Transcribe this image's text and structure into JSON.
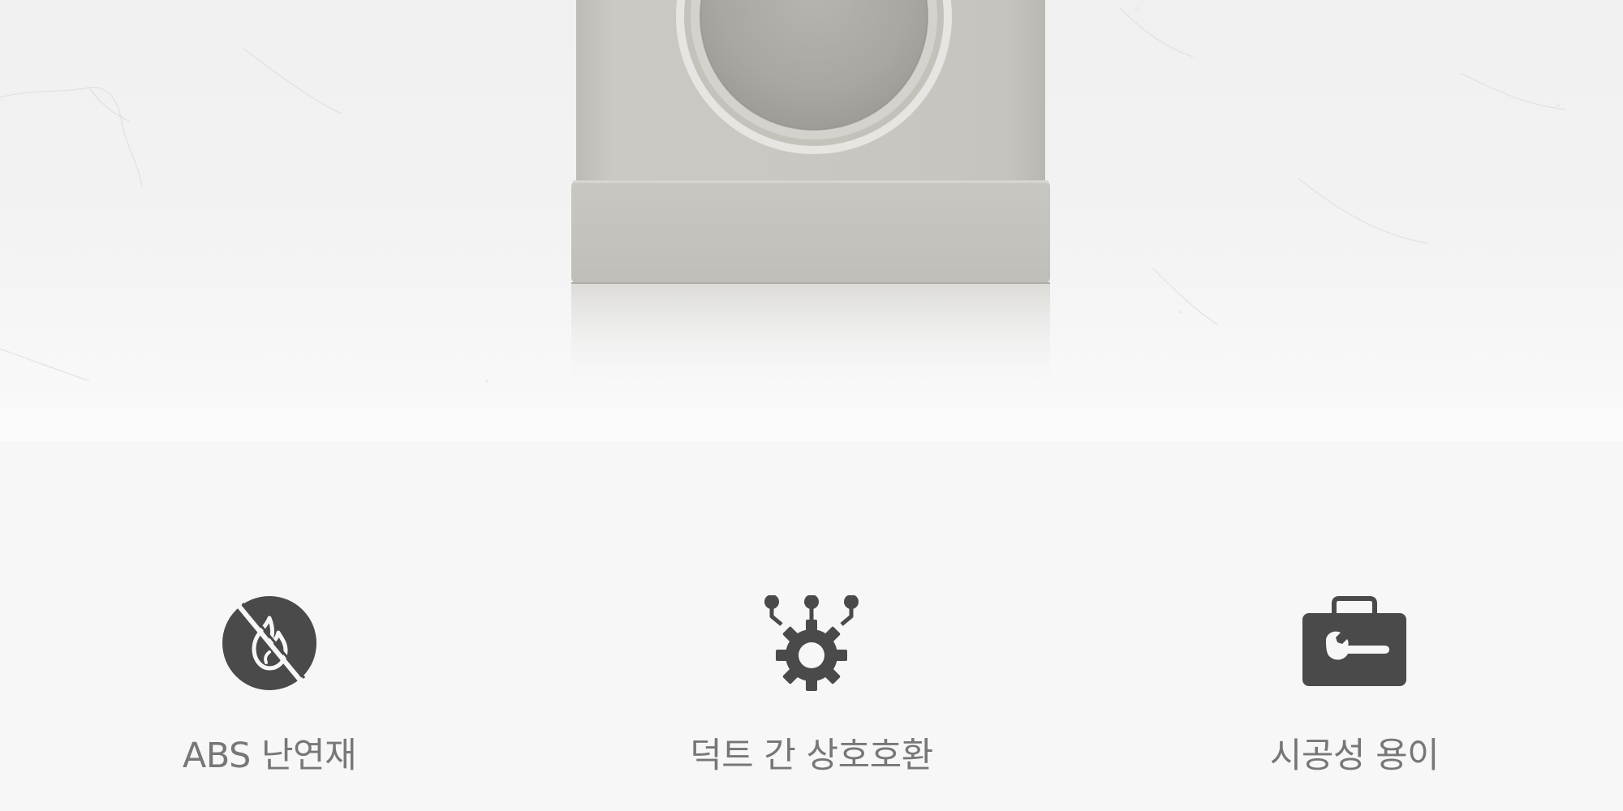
{
  "features": [
    {
      "icon": "no-fire-icon",
      "label": "ABS 난연재"
    },
    {
      "icon": "gear-connector-icon",
      "label": "덕트 간 상호호환"
    },
    {
      "icon": "toolbox-wrench-icon",
      "label": "시공성 용이"
    }
  ],
  "colors": {
    "background": "#f7f7f7",
    "icon": "#4a4a4a",
    "label": "#777777",
    "product": "#c8c6c0"
  }
}
